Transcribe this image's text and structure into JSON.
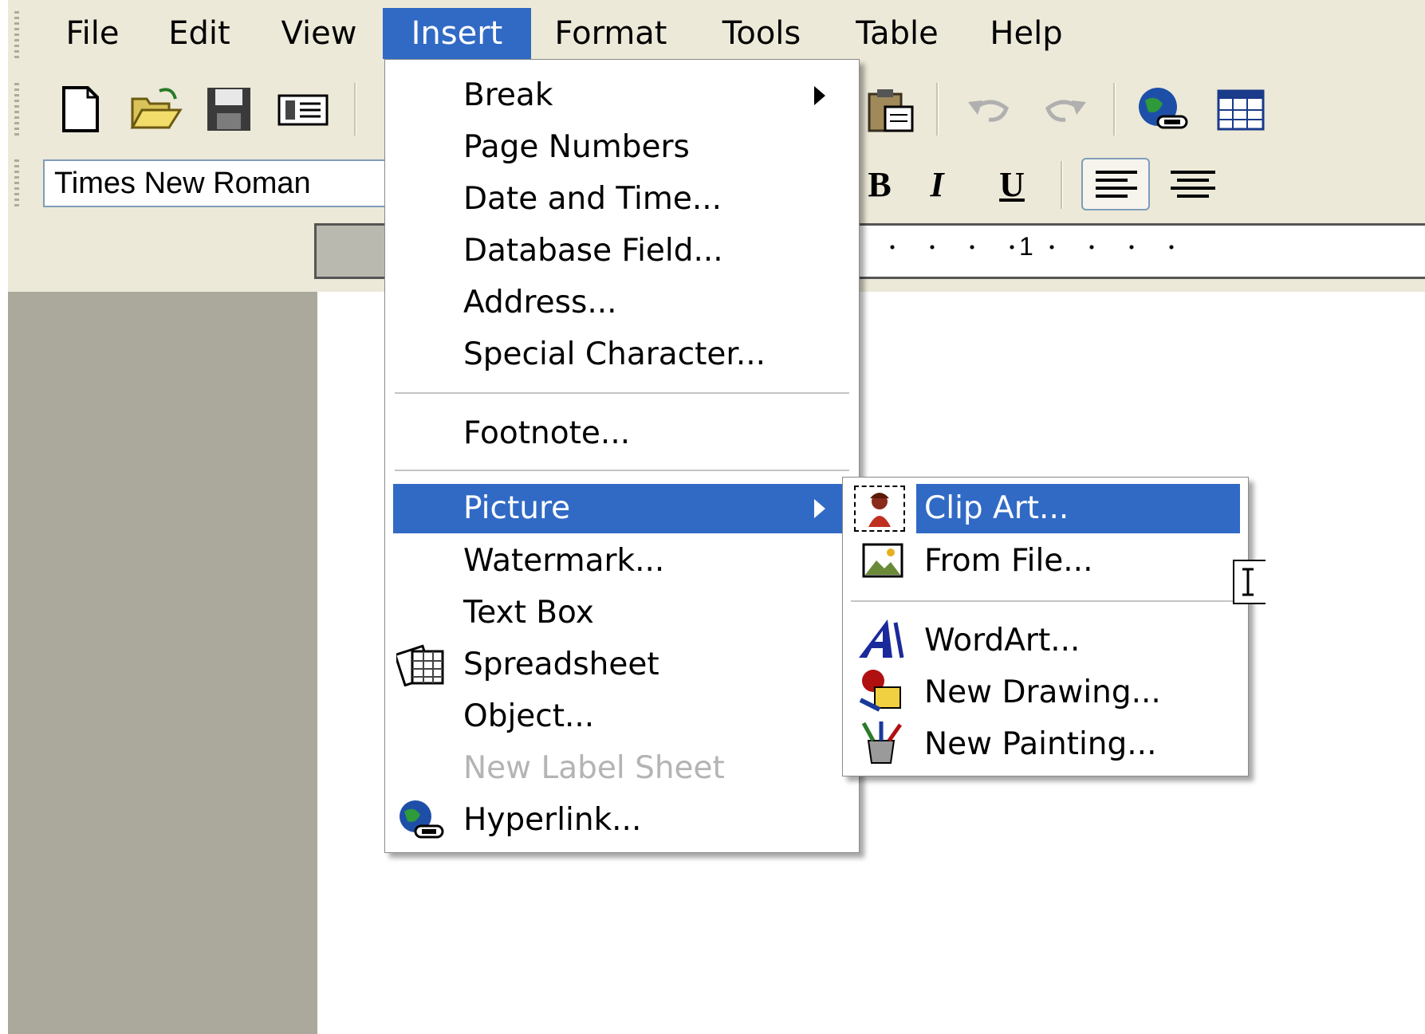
{
  "menubar": {
    "items": [
      "File",
      "Edit",
      "View",
      "Insert",
      "Format",
      "Tools",
      "Table",
      "Help"
    ],
    "active": "Insert"
  },
  "toolbar": {
    "icons": [
      "new-document-icon",
      "open-folder-icon",
      "save-icon",
      "fax-icon",
      "paste-icon",
      "undo-icon",
      "redo-icon",
      "hyperlink-icon",
      "table-icon"
    ]
  },
  "format_toolbar": {
    "font_name": "Times New Roman",
    "bold": "B",
    "italic": "I",
    "underline": "U"
  },
  "ruler": {
    "mark": "1"
  },
  "insert_menu": {
    "items": [
      {
        "label": "Break",
        "submenu": true
      },
      {
        "label": "Page Numbers"
      },
      {
        "label": "Date and Time..."
      },
      {
        "label": "Database Field..."
      },
      {
        "label": "Address..."
      },
      {
        "label": "Special Character..."
      },
      {
        "label": "Footnote..."
      },
      {
        "label": "Picture",
        "submenu": true,
        "highlighted": true
      },
      {
        "label": "Watermark..."
      },
      {
        "label": "Text Box"
      },
      {
        "label": "Spreadsheet",
        "icon": "spreadsheet-icon"
      },
      {
        "label": "Object..."
      },
      {
        "label": "New Label Sheet",
        "disabled": true
      },
      {
        "label": "Hyperlink...",
        "icon": "globe-link-icon"
      }
    ]
  },
  "picture_menu": {
    "items": [
      {
        "label": "Clip Art...",
        "icon": "clip-art-icon",
        "highlighted": true
      },
      {
        "label": "From File...",
        "icon": "image-file-icon"
      },
      {
        "label": "WordArt...",
        "icon": "wordart-icon"
      },
      {
        "label": "New Drawing...",
        "icon": "drawing-icon"
      },
      {
        "label": "New Painting...",
        "icon": "painting-icon"
      }
    ]
  },
  "colors": {
    "highlight": "#316ac5",
    "chrome": "#ece9d8",
    "doc_gray": "#aaa99b"
  }
}
